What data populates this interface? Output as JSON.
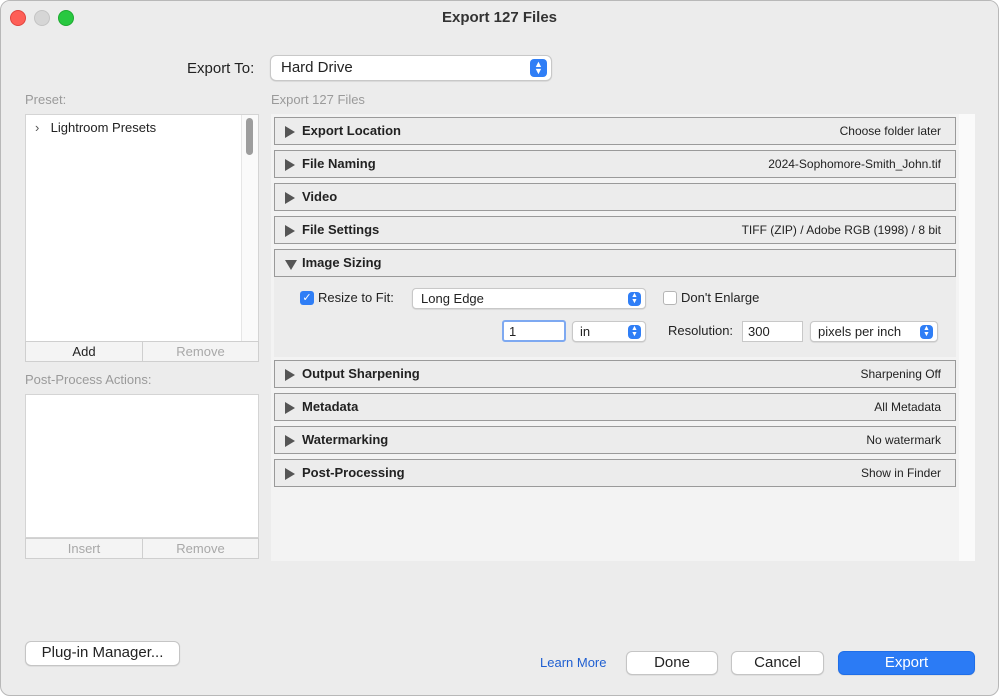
{
  "window": {
    "title": "Export 127 Files"
  },
  "export_to": {
    "label": "Export To:",
    "value": "Hard Drive"
  },
  "preset": {
    "label": "Preset:",
    "items": [
      {
        "label": "Lightroom Presets"
      }
    ],
    "add_label": "Add",
    "remove_label": "Remove"
  },
  "post_process": {
    "label": "Post-Process Actions:",
    "insert_label": "Insert",
    "remove_label": "Remove"
  },
  "settings_heading": "Export 127 Files",
  "sections": {
    "export_location": {
      "title": "Export Location",
      "summary": "Choose folder later"
    },
    "file_naming": {
      "title": "File Naming",
      "summary": "2024-Sophomore-Smith_John.tif"
    },
    "video": {
      "title": "Video",
      "summary": ""
    },
    "file_settings": {
      "title": "File Settings",
      "summary": "TIFF (ZIP) / Adobe RGB (1998) / 8 bit"
    },
    "image_sizing": {
      "title": "Image Sizing"
    },
    "output_sharpening": {
      "title": "Output Sharpening",
      "summary": "Sharpening Off"
    },
    "metadata": {
      "title": "Metadata",
      "summary": "All Metadata"
    },
    "watermarking": {
      "title": "Watermarking",
      "summary": "No watermark"
    },
    "post_processing": {
      "title": "Post-Processing",
      "summary": "Show in Finder"
    }
  },
  "image_sizing": {
    "resize_label": "Resize to Fit:",
    "resize_checked": true,
    "resize_mode": "Long Edge",
    "dont_enlarge_label": "Don't Enlarge",
    "dont_enlarge_checked": false,
    "size_value": "1",
    "size_unit": "in",
    "resolution_label": "Resolution:",
    "resolution_value": "300",
    "resolution_unit": "pixels per inch"
  },
  "footer": {
    "plugin_manager_label": "Plug-in Manager...",
    "learn_more_label": "Learn More",
    "done_label": "Done",
    "cancel_label": "Cancel",
    "export_label": "Export"
  },
  "colors": {
    "accent": "#2b7bf5",
    "close": "#fe5f57",
    "zoom": "#28c840",
    "link": "#1f5fd1"
  }
}
